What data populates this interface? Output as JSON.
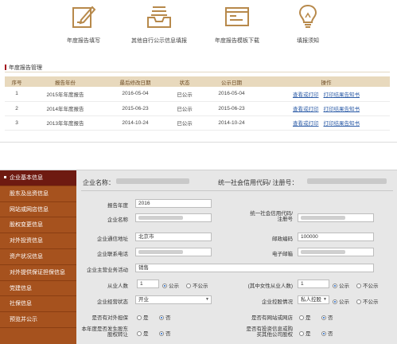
{
  "shortcuts": [
    {
      "label": "年度报告填写",
      "icon": "pencil-document-icon"
    },
    {
      "label": "其他自行公示信息填报",
      "icon": "inbox-tray-icon"
    },
    {
      "label": "年度报告模板下载",
      "icon": "browser-window-icon"
    },
    {
      "label": "填报须知",
      "icon": "lightbulb-icon"
    }
  ],
  "section_title": "年度报告管理",
  "table": {
    "headers": [
      "序号",
      "报告年份",
      "最后修改日期",
      "状态",
      "公示日期",
      "操作"
    ],
    "rows": [
      {
        "no": "1",
        "year": "2015年年度报告",
        "modified": "2016-05-04",
        "status": "已公示",
        "published": "2016-05-04",
        "op1": "查看或打印",
        "op2": "打印结果告知书"
      },
      {
        "no": "2",
        "year": "2014年年度报告",
        "modified": "2015-06-23",
        "status": "已公示",
        "published": "2015-06-23",
        "op1": "查看或打印",
        "op2": "打印结果告知书"
      },
      {
        "no": "3",
        "year": "2013年年度报告",
        "modified": "2014-10-24",
        "status": "已公示",
        "published": "2014-10-24",
        "op1": "查看或打印",
        "op2": "打印结果告知书"
      }
    ]
  },
  "sidenav": [
    "企业基本信息",
    "股东及出资信息",
    "网站或网店信息",
    "股权变更信息",
    "对外投资信息",
    "资产状况信息",
    "对外提供保证担保信息",
    "党建信息",
    "社保信息",
    "预览并公示"
  ],
  "form": {
    "company_name_label": "企业名称：",
    "credit_code_label": "统一社会信用代码/ 注册号：",
    "fields": {
      "report_year_label": "报告年度",
      "report_year_value": "2016",
      "name_label": "企业名称",
      "credit_label_1": "统一社会信用代码/",
      "credit_label_2": "注册号",
      "address_label": "企业通信地址",
      "address_value": "北京市",
      "postcode_label": "邮政编码",
      "postcode_value": "100000",
      "phone_label": "企业联系电话",
      "email_label": "电子邮箱",
      "business_label": "企业主营业务活动",
      "business_value": "销售",
      "employees_label": "从业人数",
      "employees_value": "1",
      "female_label": "(其中女性从业人数)",
      "female_value": "1",
      "status_label": "企业经营状态",
      "status_value": "开业",
      "holding_label": "企业控股情况",
      "holding_value": "私人控股",
      "guarantee_label": "是否有对外担保",
      "website_label": "是否有网站或网店",
      "transfer_label_1": "本年度是否发生股东",
      "transfer_label_2": "股权转让",
      "invest_label_1": "是否有投资信息或购",
      "invest_label_2": "买其他公司股权"
    },
    "radio_public": "公示",
    "radio_private": "不公示",
    "radio_yes": "是",
    "radio_no": "否"
  }
}
